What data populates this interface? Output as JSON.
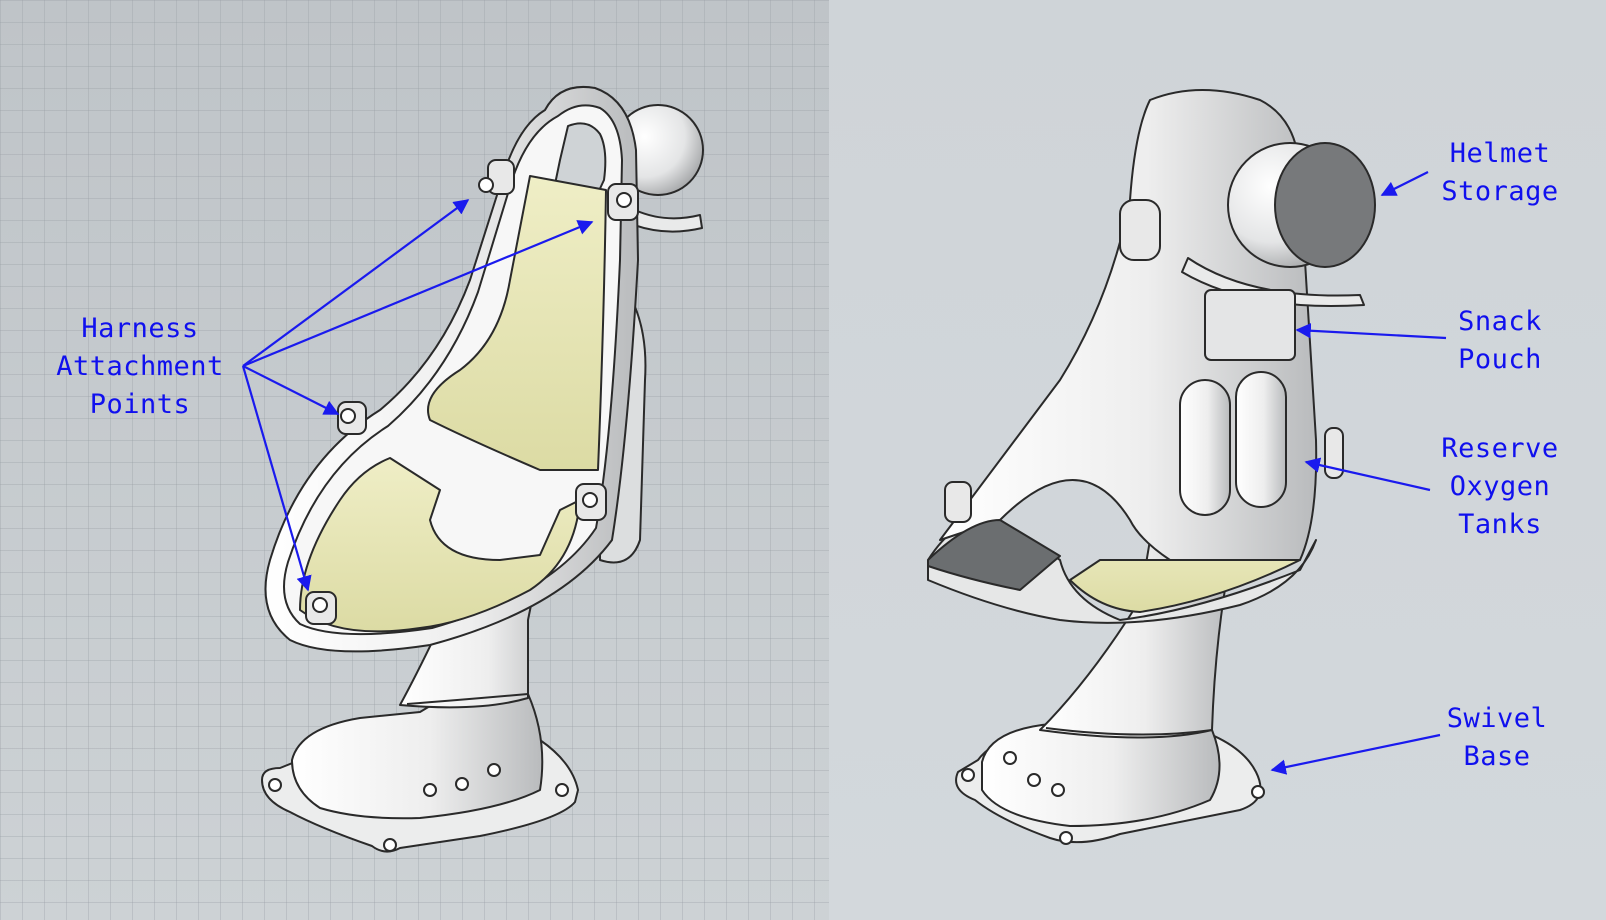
{
  "colors": {
    "label": "#1010ee",
    "arrow": "#1a1aee",
    "seat_pad": "#e8e7b5",
    "shell": "#f2f3f3",
    "outline": "#2a2a2a",
    "background": "#cdd2d6"
  },
  "labels": {
    "harness": [
      "Harness",
      "Attachment",
      "Points"
    ],
    "helmet": [
      "Helmet",
      "Storage"
    ],
    "snack": [
      "Snack",
      "Pouch"
    ],
    "oxygen": [
      "Reserve",
      "Oxygen",
      "Tanks"
    ],
    "swivel": [
      "Swivel",
      "Base"
    ]
  }
}
